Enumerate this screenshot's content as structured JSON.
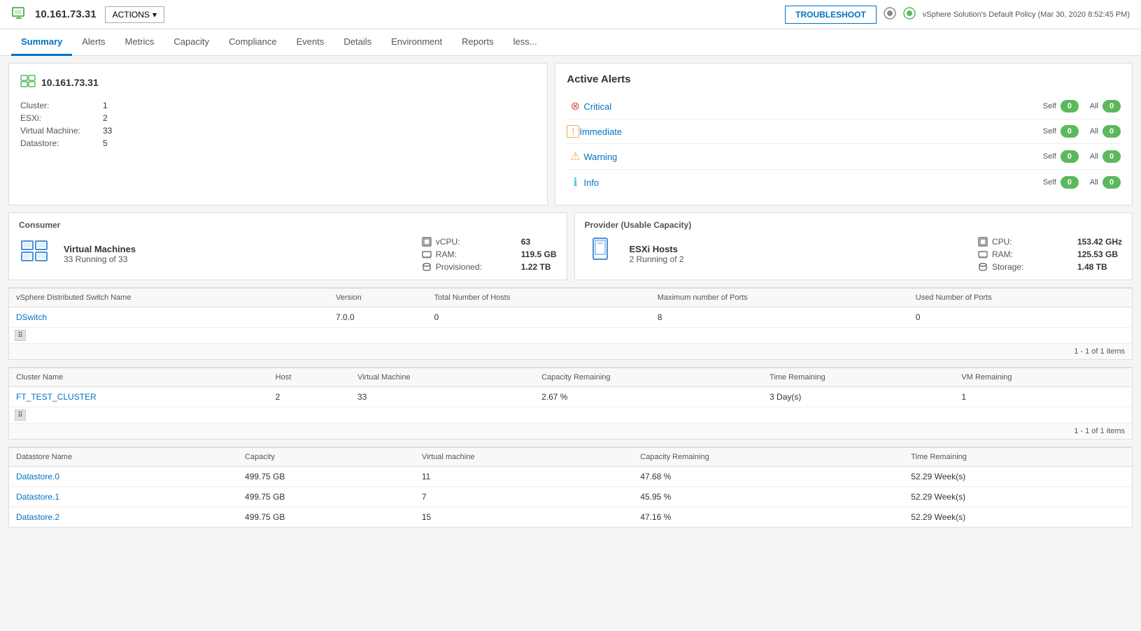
{
  "topbar": {
    "ip": "10.161.73.31",
    "actions_label": "ACTIONS",
    "troubleshoot_label": "TROUBLESHOOT",
    "policy_text": "vSphere Solution's Default Policy (Mar 30, 2020 8:52:45 PM)"
  },
  "nav": {
    "tabs": [
      {
        "label": "Summary",
        "active": true
      },
      {
        "label": "Alerts",
        "active": false
      },
      {
        "label": "Metrics",
        "active": false
      },
      {
        "label": "Capacity",
        "active": false
      },
      {
        "label": "Compliance",
        "active": false
      },
      {
        "label": "Events",
        "active": false
      },
      {
        "label": "Details",
        "active": false
      },
      {
        "label": "Environment",
        "active": false
      },
      {
        "label": "Reports",
        "active": false
      },
      {
        "label": "less...",
        "active": false
      }
    ]
  },
  "info": {
    "title": "10.161.73.31",
    "cluster_label": "Cluster:",
    "cluster_value": "1",
    "esxi_label": "ESXi:",
    "esxi_value": "2",
    "vm_label": "Virtual Machine:",
    "vm_value": "33",
    "ds_label": "Datastore:",
    "ds_value": "5"
  },
  "alerts": {
    "title": "Active Alerts",
    "items": [
      {
        "name": "Critical",
        "type": "critical",
        "self": "0",
        "all": "0"
      },
      {
        "name": "Immediate",
        "type": "immediate",
        "self": "0",
        "all": "0"
      },
      {
        "name": "Warning",
        "type": "warning",
        "self": "0",
        "all": "0"
      },
      {
        "name": "Info",
        "type": "info",
        "self": "0",
        "all": "0"
      }
    ],
    "self_label": "Self",
    "all_label": "All"
  },
  "consumer": {
    "section_label": "Consumer",
    "type": "Virtual Machines",
    "running": "33 Running of 33",
    "vcpu_label": "vCPU:",
    "vcpu_value": "63",
    "ram_label": "RAM:",
    "ram_value": "119.5 GB",
    "provisioned_label": "Provisioned:",
    "provisioned_value": "1.22 TB"
  },
  "provider": {
    "section_label": "Provider (Usable Capacity)",
    "type": "ESXi Hosts",
    "running": "2 Running of 2",
    "cpu_label": "CPU:",
    "cpu_value": "153.42 GHz",
    "ram_label": "RAM:",
    "ram_value": "125.53 GB",
    "storage_label": "Storage:",
    "storage_value": "1.48 TB"
  },
  "vswitch_table": {
    "columns": [
      "vSphere Distributed Switch Name",
      "Version",
      "Total Number of Hosts",
      "Maximum number of Ports",
      "Used Number of Ports"
    ],
    "rows": [
      {
        "name": "DSwitch",
        "version": "7.0.0",
        "total_hosts": "0",
        "max_ports": "8",
        "used_ports": "0"
      }
    ],
    "footer": "1 - 1 of 1 items"
  },
  "cluster_table": {
    "columns": [
      "Cluster Name",
      "Host",
      "Virtual Machine",
      "Capacity Remaining",
      "Time Remaining",
      "VM Remaining"
    ],
    "rows": [
      {
        "name": "FT_TEST_CLUSTER",
        "host": "2",
        "vm": "33",
        "cap_rem": "2.67 %",
        "time_rem": "3 Day(s)",
        "vm_rem": "1"
      }
    ],
    "footer": "1 - 1 of 1 items"
  },
  "datastore_table": {
    "columns": [
      "Datastore Name",
      "Capacity",
      "Virtual machine",
      "Capacity Remaining",
      "Time Remaining"
    ],
    "rows": [
      {
        "name": "Datastore.0",
        "capacity": "499.75 GB",
        "vm": "11",
        "cap_rem": "47.68 %",
        "time_rem": "52.29 Week(s)"
      },
      {
        "name": "Datastore.1",
        "capacity": "499.75 GB",
        "vm": "7",
        "cap_rem": "45.95 %",
        "time_rem": "52.29 Week(s)"
      },
      {
        "name": "Datastore.2",
        "capacity": "499.75 GB",
        "vm": "15",
        "cap_rem": "47.16 %",
        "time_rem": "52.29 Week(s)"
      }
    ]
  }
}
